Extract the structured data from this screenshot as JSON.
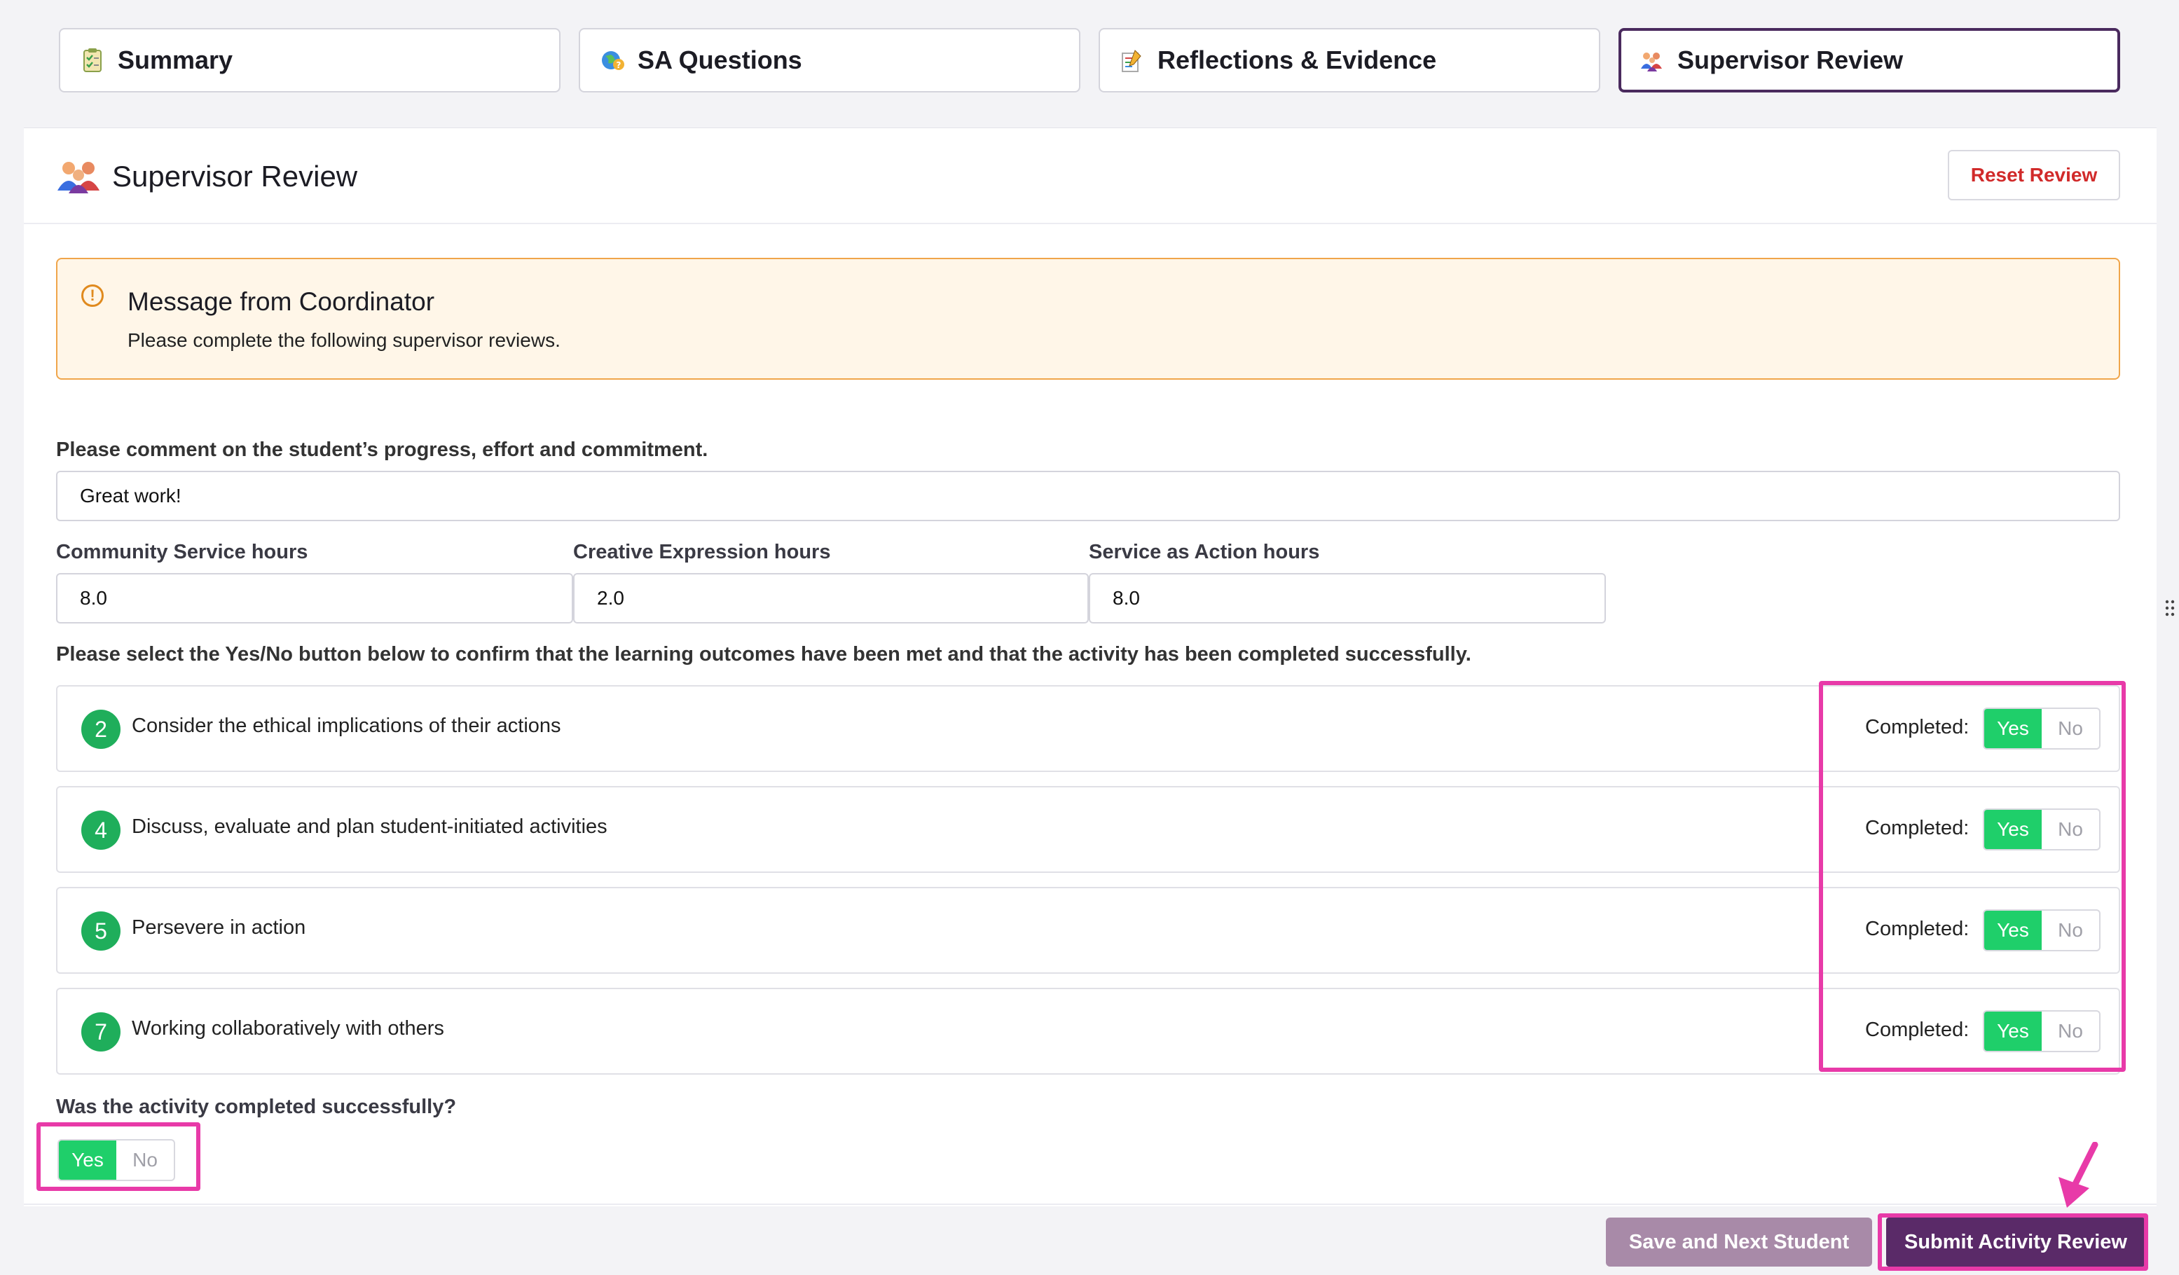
{
  "tabs": [
    {
      "label": "Summary",
      "icon": "clipboard-check-icon"
    },
    {
      "label": "SA Questions",
      "icon": "globe-question-icon"
    },
    {
      "label": "Reflections & Evidence",
      "icon": "notes-pencil-icon"
    },
    {
      "label": "Supervisor Review",
      "icon": "people-group-icon",
      "active": true
    }
  ],
  "page": {
    "title": "Supervisor Review",
    "title_icon": "people-group-icon",
    "reset_label": "Reset Review"
  },
  "message": {
    "icon": "info-icon",
    "title": "Message from Coordinator",
    "text": "Please complete the following supervisor reviews."
  },
  "comment": {
    "label": "Please comment on the student’s progress, effort and commitment.",
    "value": "Great work!"
  },
  "hours": [
    {
      "label": "Community Service hours",
      "value": "8.0"
    },
    {
      "label": "Creative Expression hours",
      "value": "2.0"
    },
    {
      "label": "Service as Action hours",
      "value": "8.0"
    }
  ],
  "instructions": "Please select the Yes/No button below to confirm that the learning outcomes have been met and that the activity has been completed successfully.",
  "outcomes": [
    {
      "number": "2",
      "text": "Consider the ethical implications of their actions",
      "completed_label": "Completed:",
      "yes": "Yes",
      "no": "No",
      "selected": "Yes"
    },
    {
      "number": "4",
      "text": "Discuss, evaluate and plan student-initiated activities",
      "completed_label": "Completed:",
      "yes": "Yes",
      "no": "No",
      "selected": "Yes"
    },
    {
      "number": "5",
      "text": "Persevere in action",
      "completed_label": "Completed:",
      "yes": "Yes",
      "no": "No",
      "selected": "Yes"
    },
    {
      "number": "7",
      "text": "Working collaboratively with others",
      "completed_label": "Completed:",
      "yes": "Yes",
      "no": "No",
      "selected": "Yes"
    }
  ],
  "activity": {
    "question": "Was the activity completed successfully?",
    "yes": "Yes",
    "no": "No",
    "selected": "Yes"
  },
  "footer": {
    "save_label": "Save and Next Student",
    "submit_label": "Submit Activity Review"
  },
  "colors": {
    "accent": "#4a2a5e",
    "success": "#1fcf6a",
    "highlight": "#e83aa8",
    "warning_border": "#f0a54a",
    "danger": "#d12a2a"
  }
}
